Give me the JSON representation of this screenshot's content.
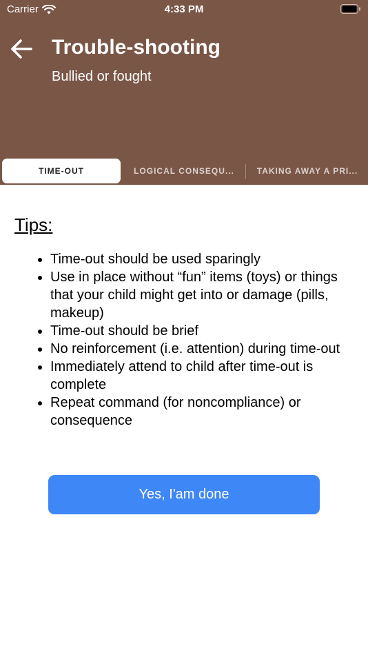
{
  "status_bar": {
    "carrier": "Carrier",
    "time": "4:33 PM"
  },
  "header": {
    "title": "Trouble-shooting",
    "subtitle": "Bullied or fought",
    "background_color": "#7a5646"
  },
  "tabs": [
    {
      "label": "TIME-OUT",
      "active": true
    },
    {
      "label": "LOGICAL CONSEQU...",
      "active": false
    },
    {
      "label": "TAKING AWAY A PRI...",
      "active": false
    }
  ],
  "content": {
    "tips_heading": "Tips:",
    "tips": [
      "Time-out should be used sparingly",
      "Use in place without “fun” items (toys) or things that your child might get into or damage (pills, makeup)",
      "Time-out should be brief",
      "No reinforcement (i.e. attention) during time-out",
      "Immediately attend to child after time-out is complete",
      "Repeat command (for noncompliance) or consequence"
    ],
    "done_button_label": "Yes, I'am done",
    "button_color": "#3e87f6"
  },
  "icons": {
    "back": "arrow-left-icon",
    "wifi": "wifi-icon",
    "battery": "battery-icon"
  }
}
